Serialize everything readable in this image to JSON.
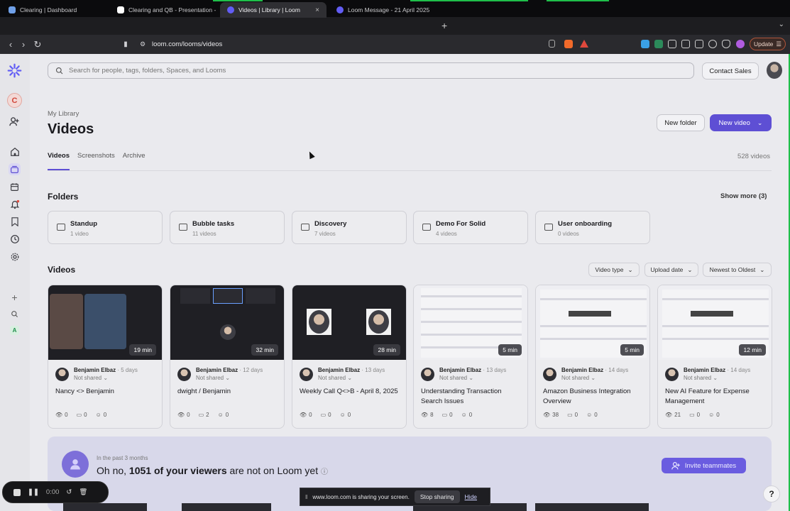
{
  "browser": {
    "tabs": [
      {
        "title": "Clearing | Dashboard",
        "favicon_color": "#6fa0e8"
      },
      {
        "title": "Clearing and QB - Presentation -",
        "favicon_color": "#ffffff"
      },
      {
        "title": "Videos | Library | Loom",
        "favicon_color": "#625df5",
        "active": true,
        "close": "×"
      },
      {
        "title": "Loom Message - 21 April 2025",
        "favicon_color": "#625df5"
      }
    ],
    "new_tab": "+",
    "url": "loom.com/looms/videos",
    "update_label": "Update"
  },
  "header": {
    "search_placeholder": "Search for people, tags, folders, Spaces, and Looms",
    "contact_sales": "Contact Sales"
  },
  "sidebar": {
    "workspace_initial": "C",
    "bottom_badge": "A",
    "icons": [
      "add-user-icon",
      "home-icon",
      "library-icon",
      "calendar-icon",
      "bell-icon",
      "bookmark-icon",
      "clock-icon",
      "gear-icon",
      "plus-icon",
      "search-icon"
    ]
  },
  "library": {
    "breadcrumb": "My Library",
    "title": "Videos",
    "new_folder": "New folder",
    "new_video": "New video",
    "tabs": [
      "Videos",
      "Screenshots",
      "Archive"
    ],
    "video_count": "528 videos"
  },
  "folders": {
    "heading": "Folders",
    "show_more": "Show more (3)",
    "items": [
      {
        "name": "Standup",
        "count": "1 video"
      },
      {
        "name": "Bubble tasks",
        "count": "11 videos"
      },
      {
        "name": "Discovery",
        "count": "7 videos"
      },
      {
        "name": "Demo For Solid",
        "count": "4 videos"
      },
      {
        "name": "User onboarding",
        "count": "0 videos"
      }
    ]
  },
  "videos": {
    "heading": "Videos",
    "filters": [
      "Video type",
      "Upload date",
      "Newest to Oldest"
    ],
    "items": [
      {
        "duration": "19 min",
        "author": "Benjamin Elbaz",
        "ago": "· 5 days",
        "shared": "Not shared",
        "title": "Nancy <> Benjamin",
        "views": "0",
        "comments": "0",
        "reactions": "0"
      },
      {
        "duration": "32 min",
        "author": "Benjamin Elbaz",
        "ago": "· 12 days",
        "shared": "Not shared",
        "title": "dwight / Benjamin",
        "views": "0",
        "comments": "2",
        "reactions": "0"
      },
      {
        "duration": "28 min",
        "author": "Benjamin Elbaz",
        "ago": "· 13 days",
        "shared": "Not shared",
        "title": "Weekly Call Q<>B - April 8, 2025",
        "views": "0",
        "comments": "0",
        "reactions": "0"
      },
      {
        "duration": "5 min",
        "author": "Benjamin Elbaz",
        "ago": "· 13 days",
        "shared": "Not shared",
        "title": "Understanding Transaction Search Issues",
        "views": "8",
        "comments": "0",
        "reactions": "0"
      },
      {
        "duration": "5 min",
        "author": "Benjamin Elbaz",
        "ago": "· 14 days",
        "shared": "Not shared",
        "title": "Amazon Business Integration Overview",
        "views": "38",
        "comments": "0",
        "reactions": "0"
      },
      {
        "duration": "12 min",
        "author": "Benjamin Elbaz",
        "ago": "· 14 days",
        "shared": "Not shared",
        "title": "New AI Feature for Expense Management",
        "views": "21",
        "comments": "0",
        "reactions": "0"
      }
    ]
  },
  "banner": {
    "small": "In the past 3 months",
    "big_prefix": "Oh no, ",
    "big_bold": "1051 of your viewers",
    "big_suffix": " are not on Loom yet",
    "invite": "Invite teammates"
  },
  "recorder": {
    "time": "0:00"
  },
  "share_notice": {
    "text": "www.loom.com is sharing your screen.",
    "stop": "Stop sharing",
    "hide": "Hide"
  },
  "help": "?",
  "colors": {
    "accent": "#5e4fd4",
    "share_border": "#1fbf4a"
  }
}
